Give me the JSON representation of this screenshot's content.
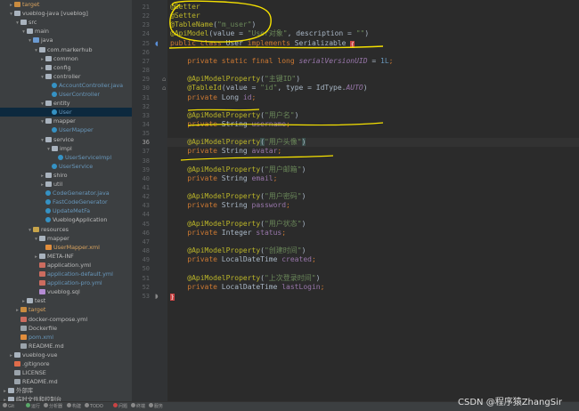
{
  "project_tree": [
    {
      "label": "target",
      "indent": 1,
      "arrow": "▸",
      "icon": "folder-target",
      "style": "orange"
    },
    {
      "label": "vueblog-java [vueblog]",
      "indent": 1,
      "arrow": "▾",
      "icon": "folder"
    },
    {
      "label": "src",
      "indent": 2,
      "arrow": "▾",
      "icon": "folder"
    },
    {
      "label": "main",
      "indent": 3,
      "arrow": "▾",
      "icon": "folder"
    },
    {
      "label": "java",
      "indent": 4,
      "arrow": "▾",
      "icon": "folder-src"
    },
    {
      "label": "com.markerhub",
      "indent": 5,
      "arrow": "▾",
      "icon": "folder"
    },
    {
      "label": "common",
      "indent": 6,
      "arrow": "▸",
      "icon": "folder"
    },
    {
      "label": "config",
      "indent": 6,
      "arrow": "▸",
      "icon": "folder"
    },
    {
      "label": "controller",
      "indent": 6,
      "arrow": "▾",
      "icon": "folder"
    },
    {
      "label": "AccountController.java",
      "indent": 7,
      "arrow": "",
      "icon": "java",
      "style": "blue"
    },
    {
      "label": "UserController",
      "indent": 7,
      "arrow": "",
      "icon": "java",
      "style": "blue"
    },
    {
      "label": "entity",
      "indent": 6,
      "arrow": "▾",
      "icon": "folder"
    },
    {
      "label": "User",
      "indent": 7,
      "arrow": "",
      "icon": "java",
      "style": "blue",
      "selected": true
    },
    {
      "label": "mapper",
      "indent": 6,
      "arrow": "▾",
      "icon": "folder"
    },
    {
      "label": "UserMapper",
      "indent": 7,
      "arrow": "",
      "icon": "java",
      "style": "blue"
    },
    {
      "label": "service",
      "indent": 6,
      "arrow": "▾",
      "icon": "folder"
    },
    {
      "label": "impl",
      "indent": 7,
      "arrow": "▾",
      "icon": "folder"
    },
    {
      "label": "UserServiceImpl",
      "indent": 8,
      "arrow": "",
      "icon": "java",
      "style": "blue"
    },
    {
      "label": "UserService",
      "indent": 7,
      "arrow": "",
      "icon": "java",
      "style": "blue"
    },
    {
      "label": "shiro",
      "indent": 6,
      "arrow": "▸",
      "icon": "folder"
    },
    {
      "label": "util",
      "indent": 6,
      "arrow": "▸",
      "icon": "folder"
    },
    {
      "label": "CodeGenerator.java",
      "indent": 6,
      "arrow": "",
      "icon": "java",
      "style": "blue"
    },
    {
      "label": "FastCodeGenerator",
      "indent": 6,
      "arrow": "",
      "icon": "java",
      "style": "blue"
    },
    {
      "label": "UpdateMetFa",
      "indent": 6,
      "arrow": "",
      "icon": "java",
      "style": "blue"
    },
    {
      "label": "VueblogApplication",
      "indent": 6,
      "arrow": "",
      "icon": "java"
    },
    {
      "label": "resources",
      "indent": 4,
      "arrow": "▾",
      "icon": "folder-res"
    },
    {
      "label": "mapper",
      "indent": 5,
      "arrow": "▾",
      "icon": "folder"
    },
    {
      "label": "UserMapper.xml",
      "indent": 6,
      "arrow": "",
      "icon": "xml",
      "style": "orange"
    },
    {
      "label": "META-INF",
      "indent": 5,
      "arrow": "▸",
      "icon": "folder"
    },
    {
      "label": "application.yml",
      "indent": 5,
      "arrow": "",
      "icon": "yml"
    },
    {
      "label": "application-default.yml",
      "indent": 5,
      "arrow": "",
      "icon": "yml",
      "style": "blue"
    },
    {
      "label": "application-pro.yml",
      "indent": 5,
      "arrow": "",
      "icon": "yml",
      "style": "blue"
    },
    {
      "label": "vueblog.sql",
      "indent": 5,
      "arrow": "",
      "icon": "sql"
    },
    {
      "label": "test",
      "indent": 3,
      "arrow": "▸",
      "icon": "folder"
    },
    {
      "label": "target",
      "indent": 2,
      "arrow": "▸",
      "icon": "folder-target",
      "style": "orange"
    },
    {
      "label": "docker-compose.yml",
      "indent": 2,
      "arrow": "",
      "icon": "yml"
    },
    {
      "label": "Dockerfile",
      "indent": 2,
      "arrow": "",
      "icon": "file"
    },
    {
      "label": "pom.xml",
      "indent": 2,
      "arrow": "",
      "icon": "xml",
      "style": "blue"
    },
    {
      "label": "README.md",
      "indent": 2,
      "arrow": "",
      "icon": "file"
    },
    {
      "label": "vueblog-vue",
      "indent": 1,
      "arrow": "▸",
      "icon": "folder"
    },
    {
      "label": ".gitignore",
      "indent": 1,
      "arrow": "",
      "icon": "git"
    },
    {
      "label": "LICENSE",
      "indent": 1,
      "arrow": "",
      "icon": "file"
    },
    {
      "label": "README.md",
      "indent": 1,
      "arrow": "",
      "icon": "file"
    },
    {
      "label": "外部库",
      "indent": 0,
      "arrow": "▸",
      "icon": "folder"
    },
    {
      "label": "临时文件和控制台",
      "indent": 0,
      "arrow": "▸",
      "icon": "folder"
    }
  ],
  "editor": {
    "current_line": 36,
    "lines": [
      {
        "n": 21,
        "tokens": [
          {
            "t": "@Getter",
            "c": "ann"
          }
        ]
      },
      {
        "n": 22,
        "tokens": [
          {
            "t": "@Setter",
            "c": "ann"
          }
        ]
      },
      {
        "n": 23,
        "tokens": [
          {
            "t": "@TableName",
            "c": "ann"
          },
          {
            "t": "("
          },
          {
            "t": "\"m_user\"",
            "c": "str"
          },
          {
            "t": ")"
          }
        ]
      },
      {
        "n": 24,
        "tokens": [
          {
            "t": "@ApiModel",
            "c": "ann"
          },
          {
            "t": "(value = "
          },
          {
            "t": "\"User对象\"",
            "c": "str"
          },
          {
            "t": ", description = "
          },
          {
            "t": "\"\"",
            "c": "str"
          },
          {
            "t": ")"
          }
        ]
      },
      {
        "n": 25,
        "tokens": [
          {
            "t": "public class ",
            "c": "kw"
          },
          {
            "t": "User "
          },
          {
            "t": "implements ",
            "c": "kw"
          },
          {
            "t": "Serializable "
          },
          {
            "t": "{",
            "c": "err"
          }
        ]
      },
      {
        "n": 26,
        "tokens": []
      },
      {
        "n": 27,
        "tokens": [
          {
            "t": "    "
          },
          {
            "t": "private static final long ",
            "c": "kw"
          },
          {
            "t": "serialVersionUID",
            "c": "fld itl"
          },
          {
            "t": " = "
          },
          {
            "t": "1L",
            "c": "num"
          },
          {
            "t": ";",
            "c": "kw"
          }
        ]
      },
      {
        "n": 28,
        "tokens": []
      },
      {
        "n": 29,
        "tokens": [
          {
            "t": "    "
          },
          {
            "t": "@ApiModelProperty",
            "c": "ann"
          },
          {
            "t": "("
          },
          {
            "t": "\"主键ID\"",
            "c": "str"
          },
          {
            "t": ")"
          }
        ]
      },
      {
        "n": 30,
        "tokens": [
          {
            "t": "    "
          },
          {
            "t": "@TableId",
            "c": "ann"
          },
          {
            "t": "(value = "
          },
          {
            "t": "\"id\"",
            "c": "str"
          },
          {
            "t": ", type = IdType."
          },
          {
            "t": "AUTO",
            "c": "fld itl"
          },
          {
            "t": ")"
          }
        ]
      },
      {
        "n": 31,
        "tokens": [
          {
            "t": "    "
          },
          {
            "t": "private ",
            "c": "kw"
          },
          {
            "t": "Long "
          },
          {
            "t": "id",
            "c": "fld"
          },
          {
            "t": ";",
            "c": "kw"
          }
        ]
      },
      {
        "n": 32,
        "tokens": []
      },
      {
        "n": 33,
        "tokens": [
          {
            "t": "    "
          },
          {
            "t": "@ApiModelProperty",
            "c": "ann"
          },
          {
            "t": "("
          },
          {
            "t": "\"用户名\"",
            "c": "str"
          },
          {
            "t": ")"
          }
        ]
      },
      {
        "n": 34,
        "tokens": [
          {
            "t": "    "
          },
          {
            "t": "private ",
            "c": "kw"
          },
          {
            "t": "String "
          },
          {
            "t": "username",
            "c": "fld"
          },
          {
            "t": ";",
            "c": "kw"
          }
        ]
      },
      {
        "n": 35,
        "tokens": []
      },
      {
        "n": 36,
        "tokens": [
          {
            "t": "    "
          },
          {
            "t": "@ApiModelProperty",
            "c": "ann"
          },
          {
            "t": "(",
            "c": "hl"
          },
          {
            "t": "\"用户头像\"",
            "c": "str"
          },
          {
            "t": ")",
            "c": "hl"
          }
        ]
      },
      {
        "n": 37,
        "tokens": [
          {
            "t": "    "
          },
          {
            "t": "private ",
            "c": "kw"
          },
          {
            "t": "String "
          },
          {
            "t": "avatar",
            "c": "fld"
          },
          {
            "t": ";",
            "c": "kw"
          }
        ]
      },
      {
        "n": 38,
        "tokens": []
      },
      {
        "n": 39,
        "tokens": [
          {
            "t": "    "
          },
          {
            "t": "@ApiModelProperty",
            "c": "ann"
          },
          {
            "t": "("
          },
          {
            "t": "\"用户邮箱\"",
            "c": "str"
          },
          {
            "t": ")"
          }
        ]
      },
      {
        "n": 40,
        "tokens": [
          {
            "t": "    "
          },
          {
            "t": "private ",
            "c": "kw"
          },
          {
            "t": "String "
          },
          {
            "t": "email",
            "c": "fld"
          },
          {
            "t": ";",
            "c": "kw"
          }
        ]
      },
      {
        "n": 41,
        "tokens": []
      },
      {
        "n": 42,
        "tokens": [
          {
            "t": "    "
          },
          {
            "t": "@ApiModelProperty",
            "c": "ann"
          },
          {
            "t": "("
          },
          {
            "t": "\"用户密码\"",
            "c": "str"
          },
          {
            "t": ")"
          }
        ]
      },
      {
        "n": 43,
        "tokens": [
          {
            "t": "    "
          },
          {
            "t": "private ",
            "c": "kw"
          },
          {
            "t": "String "
          },
          {
            "t": "password",
            "c": "fld"
          },
          {
            "t": ";",
            "c": "kw"
          }
        ]
      },
      {
        "n": 44,
        "tokens": []
      },
      {
        "n": 45,
        "tokens": [
          {
            "t": "    "
          },
          {
            "t": "@ApiModelProperty",
            "c": "ann"
          },
          {
            "t": "("
          },
          {
            "t": "\"用户状态\"",
            "c": "str"
          },
          {
            "t": ")"
          }
        ]
      },
      {
        "n": 46,
        "tokens": [
          {
            "t": "    "
          },
          {
            "t": "private ",
            "c": "kw"
          },
          {
            "t": "Integer "
          },
          {
            "t": "status",
            "c": "fld"
          },
          {
            "t": ";",
            "c": "kw"
          }
        ]
      },
      {
        "n": 47,
        "tokens": []
      },
      {
        "n": 48,
        "tokens": [
          {
            "t": "    "
          },
          {
            "t": "@ApiModelProperty",
            "c": "ann"
          },
          {
            "t": "("
          },
          {
            "t": "\"创建时间\"",
            "c": "str"
          },
          {
            "t": ")"
          }
        ]
      },
      {
        "n": 49,
        "tokens": [
          {
            "t": "    "
          },
          {
            "t": "private ",
            "c": "kw"
          },
          {
            "t": "LocalDateTime "
          },
          {
            "t": "created",
            "c": "fld"
          },
          {
            "t": ";",
            "c": "kw"
          }
        ]
      },
      {
        "n": 50,
        "tokens": []
      },
      {
        "n": 51,
        "tokens": [
          {
            "t": "    "
          },
          {
            "t": "@ApiModelProperty",
            "c": "ann"
          },
          {
            "t": "("
          },
          {
            "t": "\"上次登录时间\"",
            "c": "str"
          },
          {
            "t": ")"
          }
        ]
      },
      {
        "n": 52,
        "tokens": [
          {
            "t": "    "
          },
          {
            "t": "private ",
            "c": "kw"
          },
          {
            "t": "LocalDateTime "
          },
          {
            "t": "lastLogin",
            "c": "fld"
          },
          {
            "t": ";",
            "c": "kw"
          }
        ]
      },
      {
        "n": 53,
        "tokens": [
          {
            "t": "}",
            "c": "err"
          }
        ]
      }
    ]
  },
  "status_bar": [
    {
      "label": "Git",
      "color": "#8a8a8a"
    },
    {
      "label": "运行",
      "color": "#59a869"
    },
    {
      "label": "分析器",
      "color": "#8a8a8a"
    },
    {
      "label": "构建",
      "color": "#8a8a8a"
    },
    {
      "label": "TODO",
      "color": "#8a8a8a"
    },
    {
      "label": "问题",
      "color": "#c94444"
    },
    {
      "label": "终端",
      "color": "#8a8a8a"
    },
    {
      "label": "服务",
      "color": "#8a8a8a"
    }
  ],
  "watermark": "CSDN @程序猿ZhangSir",
  "colors": {
    "annotation_marker": "#f5e100",
    "keyword": "#cc7832",
    "string": "#6a8759",
    "annotation": "#bbb529",
    "field": "#9876aa"
  }
}
